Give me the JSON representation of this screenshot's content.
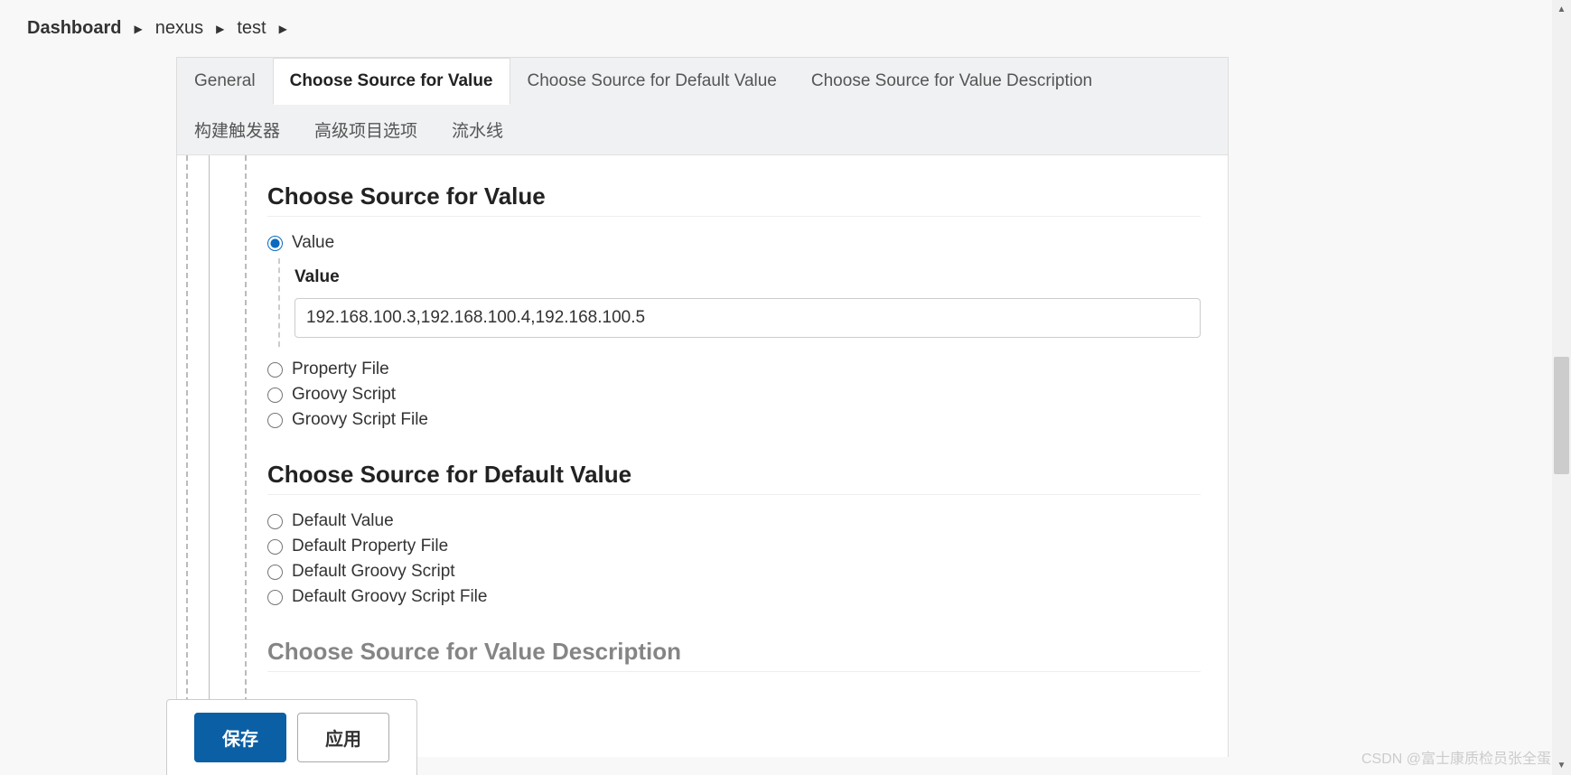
{
  "breadcrumb": {
    "items": [
      "Dashboard",
      "nexus",
      "test"
    ]
  },
  "tabs": [
    {
      "label": "General",
      "active": false
    },
    {
      "label": "Choose Source for Value",
      "active": true
    },
    {
      "label": "Choose Source for Default Value",
      "active": false
    },
    {
      "label": "Choose Source for Value Description",
      "active": false
    },
    {
      "label": "构建触发器",
      "active": false
    },
    {
      "label": "高级项目选项",
      "active": false
    },
    {
      "label": "流水线",
      "active": false
    }
  ],
  "sections": {
    "source_value": {
      "title": "Choose Source for Value",
      "options": {
        "value": "Value",
        "property_file": "Property File",
        "groovy_script": "Groovy Script",
        "groovy_script_file": "Groovy Script File"
      },
      "selected": "value",
      "value_field": {
        "label": "Value",
        "input": "192.168.100.3,192.168.100.4,192.168.100.5"
      }
    },
    "source_default": {
      "title": "Choose Source for Default Value",
      "options": {
        "default_value": "Default Value",
        "default_property_file": "Default Property File",
        "default_groovy_script": "Default Groovy Script",
        "default_groovy_script_file": "Default Groovy Script File"
      }
    },
    "source_description": {
      "title": "Choose Source for Value Description"
    }
  },
  "footer": {
    "save": "保存",
    "apply": "应用"
  },
  "watermark": "CSDN @富士康质检员张全蛋"
}
